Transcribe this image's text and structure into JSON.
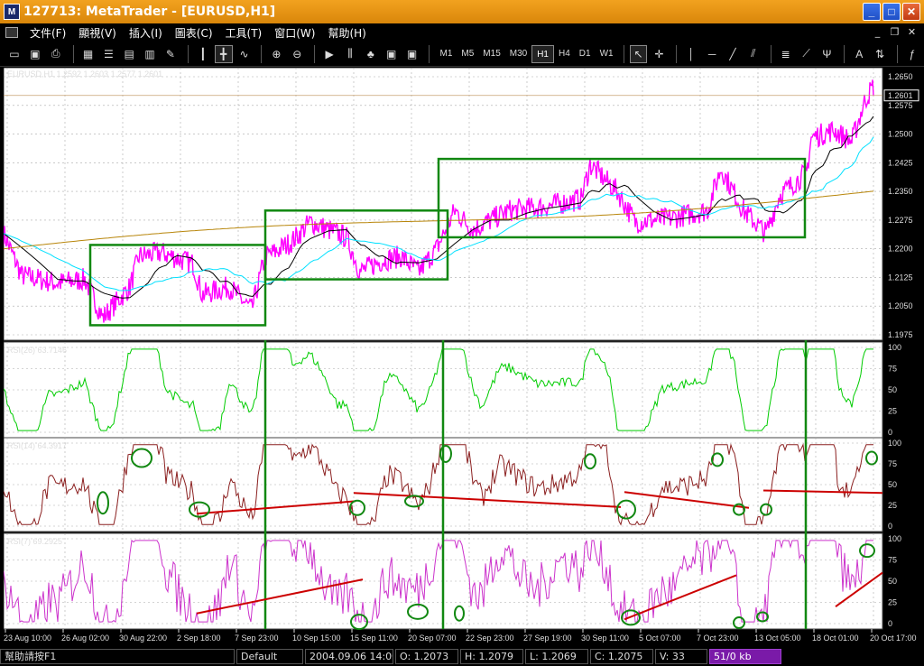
{
  "window": {
    "title": "127713: MetaTrader - [EURUSD,H1]"
  },
  "menu": [
    "文件(F)",
    "顯視(V)",
    "插入(I)",
    "圖表(C)",
    "工具(T)",
    "窗口(W)",
    "幫助(H)"
  ],
  "timeframes": [
    "M1",
    "M5",
    "M15",
    "M30",
    "H1",
    "H4",
    "D1",
    "W1"
  ],
  "selected_timeframe": "H1",
  "chart": {
    "info": "EURUSD,H1  1.2592 1.2603 1.2577 1.2601",
    "current_price": "1.2601",
    "price_ticks": [
      "1.2650",
      "1.2575",
      "1.2500",
      "1.2425",
      "1.2350",
      "1.2275",
      "1.2200",
      "1.2125",
      "1.2050",
      "1.1975"
    ],
    "rsi26_label": "RSI(26)  63.7146",
    "rsi14_label": "RSI(14)  64.3917",
    "rsi7_label": "RSI(7)  69.2925",
    "rsi_ticks": [
      "100",
      "75",
      "50",
      "25",
      "0"
    ],
    "time_labels": [
      "23 Aug 10:00",
      "26 Aug 02:00",
      "30 Aug 22:00",
      "2 Sep 18:00",
      "7 Sep 23:00",
      "10 Sep 15:00",
      "15 Sep 11:00",
      "20 Sep 07:00",
      "22 Sep 23:00",
      "27 Sep 19:00",
      "30 Sep 11:00",
      "5 Oct 07:00",
      "7 Oct 23:00",
      "13 Oct 05:00",
      "18 Oct 01:00",
      "20 Oct 17:00"
    ],
    "colors": {
      "price": "#ff00ff",
      "ma_black": "#000000",
      "ma_cyan": "#00e0ff",
      "ma_gold": "#b8860b",
      "box": "#118811",
      "rsi26": "#00cc00",
      "rsi14": "#8b2020",
      "rsi7": "#cc33cc",
      "trend": "#cc0000",
      "bg": "#ffffff"
    }
  },
  "status": {
    "help": "幫助請按F1",
    "profile": "Default",
    "datetime": "2004.09.06 14:00",
    "open": "O: 1.2073",
    "high": "H: 1.2079",
    "low": "L: 1.2069",
    "close": "C: 1.2075",
    "volume": "V: 33",
    "traffic": "51/0 kb"
  }
}
